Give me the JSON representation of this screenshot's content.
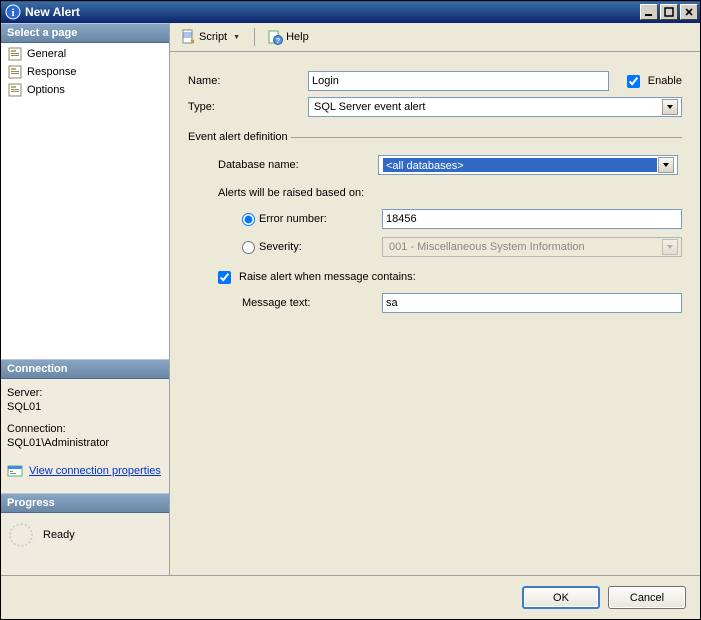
{
  "window": {
    "title": "New Alert"
  },
  "left": {
    "select_page_header": "Select a page",
    "pages": [
      {
        "label": "General",
        "selected": true
      },
      {
        "label": "Response",
        "selected": false
      },
      {
        "label": "Options",
        "selected": false
      }
    ],
    "connection": {
      "header": "Connection",
      "server_label": "Server:",
      "server_value": "SQL01",
      "conn_label": "Connection:",
      "conn_value": "SQL01\\Administrator",
      "link_text": "View connection properties"
    },
    "progress": {
      "header": "Progress",
      "status": "Ready"
    }
  },
  "toolbar": {
    "script_label": "Script",
    "help_label": "Help"
  },
  "form": {
    "name_label": "Name:",
    "name_value": "Login",
    "enable_label": "Enable",
    "enable_checked": true,
    "type_label": "Type:",
    "type_value": "SQL Server event alert",
    "event_def_header": "Event alert definition",
    "db_label": "Database name:",
    "db_value": "<all databases>",
    "alerts_based_label": "Alerts will be raised based on:",
    "error_number_label": "Error number:",
    "error_number_value": "18456",
    "severity_label": "Severity:",
    "severity_value": "001 - Miscellaneous System Information",
    "raise_contains_label": "Raise alert when message contains:",
    "raise_contains_checked": true,
    "message_text_label": "Message text:",
    "message_text_value": "sa"
  },
  "buttons": {
    "ok": "OK",
    "cancel": "Cancel"
  }
}
